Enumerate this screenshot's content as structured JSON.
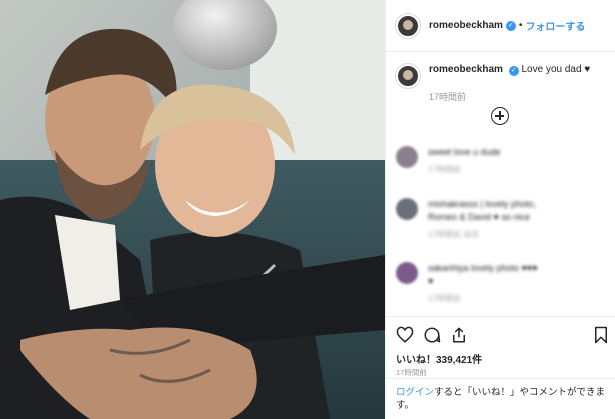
{
  "header": {
    "username": "romeobeckham",
    "separator": "•",
    "follow_label": "フォローする"
  },
  "caption": {
    "username": "romeobeckham",
    "text": "Love you dad ♥",
    "time": "17時間前"
  },
  "comments": [
    {
      "line1": "sweet love u dude",
      "line2": "",
      "meta": "17時間前",
      "avatar_color": "#8a7f8c"
    },
    {
      "line1": "mishakrasss | lovely photo,",
      "line2": "Romeo & David ♥ so nice",
      "meta": "17時間前 返信",
      "avatar_color": "#6b6f7a"
    },
    {
      "line1": "sakanhiya lovely photo ♥♥♥",
      "line2": "♥",
      "meta": "17時間前",
      "avatar_color": "#7d5a8c"
    }
  ],
  "actions": {
    "likes_label": "いいね！339,421件",
    "post_time": "17時間前"
  },
  "login": {
    "link": "ログイン",
    "text": "すると「いいね！」やコメントができます。"
  },
  "colors": {
    "link_blue": "#3897f0",
    "verified_blue": "#3897f0",
    "border": "#efefef",
    "muted": "#999999"
  },
  "icons": [
    "heart-icon",
    "comment-icon",
    "share-icon",
    "bookmark-icon",
    "add-circle-icon",
    "verified-badge-icon"
  ]
}
